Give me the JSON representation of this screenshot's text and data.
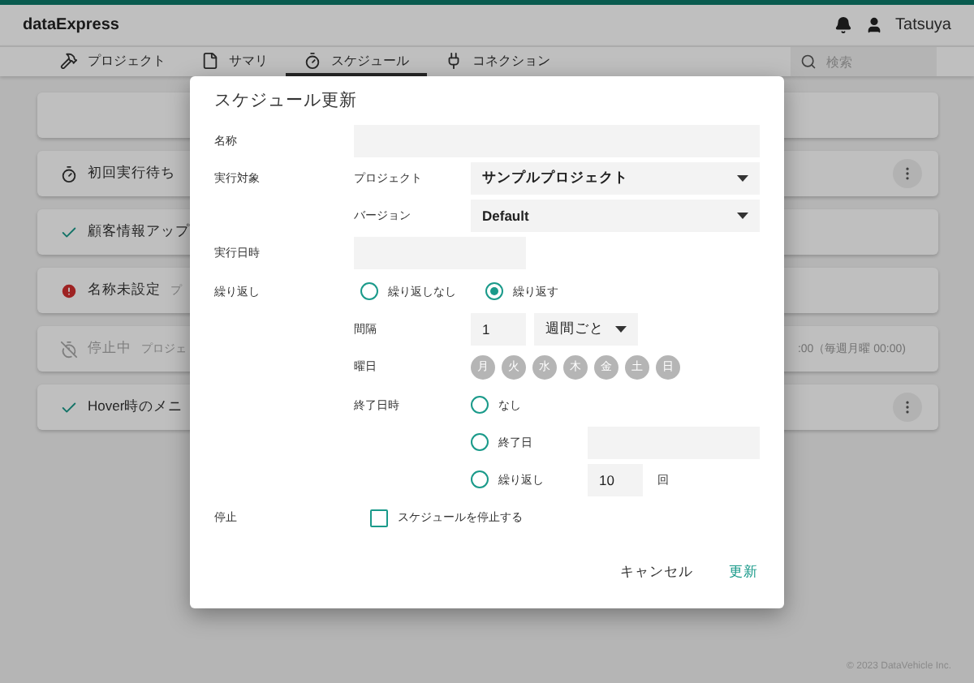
{
  "header": {
    "logo": "dataExpress",
    "user": "Tatsuya"
  },
  "tabs": [
    {
      "label": "プロジェクト",
      "kind": "tools",
      "selected": false
    },
    {
      "label": "サマリ",
      "kind": "file",
      "selected": false
    },
    {
      "label": "スケジュール",
      "kind": "timer",
      "selected": true
    },
    {
      "label": "コネクション",
      "kind": "plug",
      "selected": false
    }
  ],
  "search": {
    "placeholder": "検索"
  },
  "schedules": [
    {
      "kind": "blank",
      "menu": false
    },
    {
      "kind": "waiting",
      "title": "初回実行待ち",
      "menu": true
    },
    {
      "kind": "success",
      "title": "顧客情報アップ",
      "menu": false
    },
    {
      "kind": "error",
      "title": "名称未設定",
      "sub": "プ",
      "menu": false
    },
    {
      "kind": "stopped",
      "title": "停止中",
      "sub": "プロジェ",
      "right": ":00（毎週月曜 00:00)",
      "menu": false
    },
    {
      "kind": "success",
      "title": "Hover時のメニ",
      "menu": true
    }
  ],
  "dialog": {
    "title": "スケジュール更新",
    "name_label": "名称",
    "target_label": "実行対象",
    "project_label": "プロジェクト",
    "project_value": "サンプルプロジェクト",
    "version_label": "バージョン",
    "version_value": "Default",
    "datetime_label": "実行日時",
    "repeat_label": "繰り返し",
    "repeat_options": [
      {
        "label": "繰り返しなし",
        "selected": false
      },
      {
        "label": "繰り返す",
        "selected": true
      }
    ],
    "interval_label": "間隔",
    "interval_value": "1",
    "interval_unit": "週間ごと",
    "days_label": "曜日",
    "days": [
      {
        "label": "月",
        "selected": false
      },
      {
        "label": "火",
        "selected": false
      },
      {
        "label": "水",
        "selected": false
      },
      {
        "label": "木",
        "selected": false
      },
      {
        "label": "金",
        "selected": false
      },
      {
        "label": "土",
        "selected": false
      },
      {
        "label": "日",
        "selected": false
      }
    ],
    "end_label": "終了日時",
    "end_options": [
      {
        "kind": "none",
        "label": "なし",
        "selected": false
      },
      {
        "kind": "date",
        "label": "終了日",
        "selected": false
      },
      {
        "kind": "count",
        "label": "繰り返し",
        "selected": false,
        "value": "10",
        "unit": "回"
      }
    ],
    "stop_label": "停止",
    "stop_checkbox": {
      "label": "スケジュールを停止する",
      "checked": false
    },
    "buttons": [
      {
        "label": "キャンセル",
        "kind": "cancel"
      },
      {
        "label": "更新",
        "kind": "primary"
      }
    ]
  },
  "copyright": "© 2023 DataVehicle Inc."
}
